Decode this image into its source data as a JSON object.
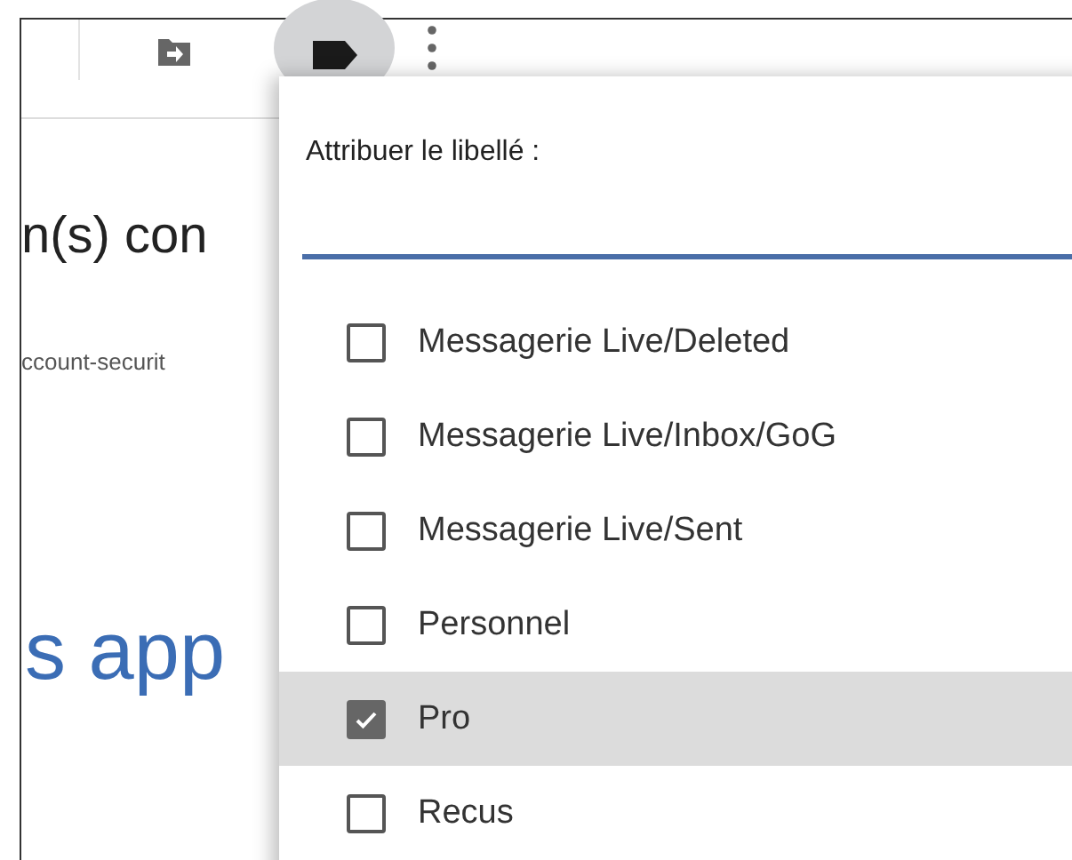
{
  "background": {
    "heading": "n(s) con",
    "link": "ccount-securit",
    "title": "s app"
  },
  "label_menu": {
    "title": "Attribuer le libellé :",
    "labels": [
      {
        "name": "Messagerie Live/Deleted",
        "checked": false,
        "selected": false
      },
      {
        "name": "Messagerie Live/Inbox/GoG",
        "checked": false,
        "selected": false
      },
      {
        "name": "Messagerie Live/Sent",
        "checked": false,
        "selected": false
      },
      {
        "name": "Personnel",
        "checked": false,
        "selected": false
      },
      {
        "name": "Pro",
        "checked": true,
        "selected": true
      },
      {
        "name": "Recus",
        "checked": false,
        "selected": false
      }
    ]
  }
}
